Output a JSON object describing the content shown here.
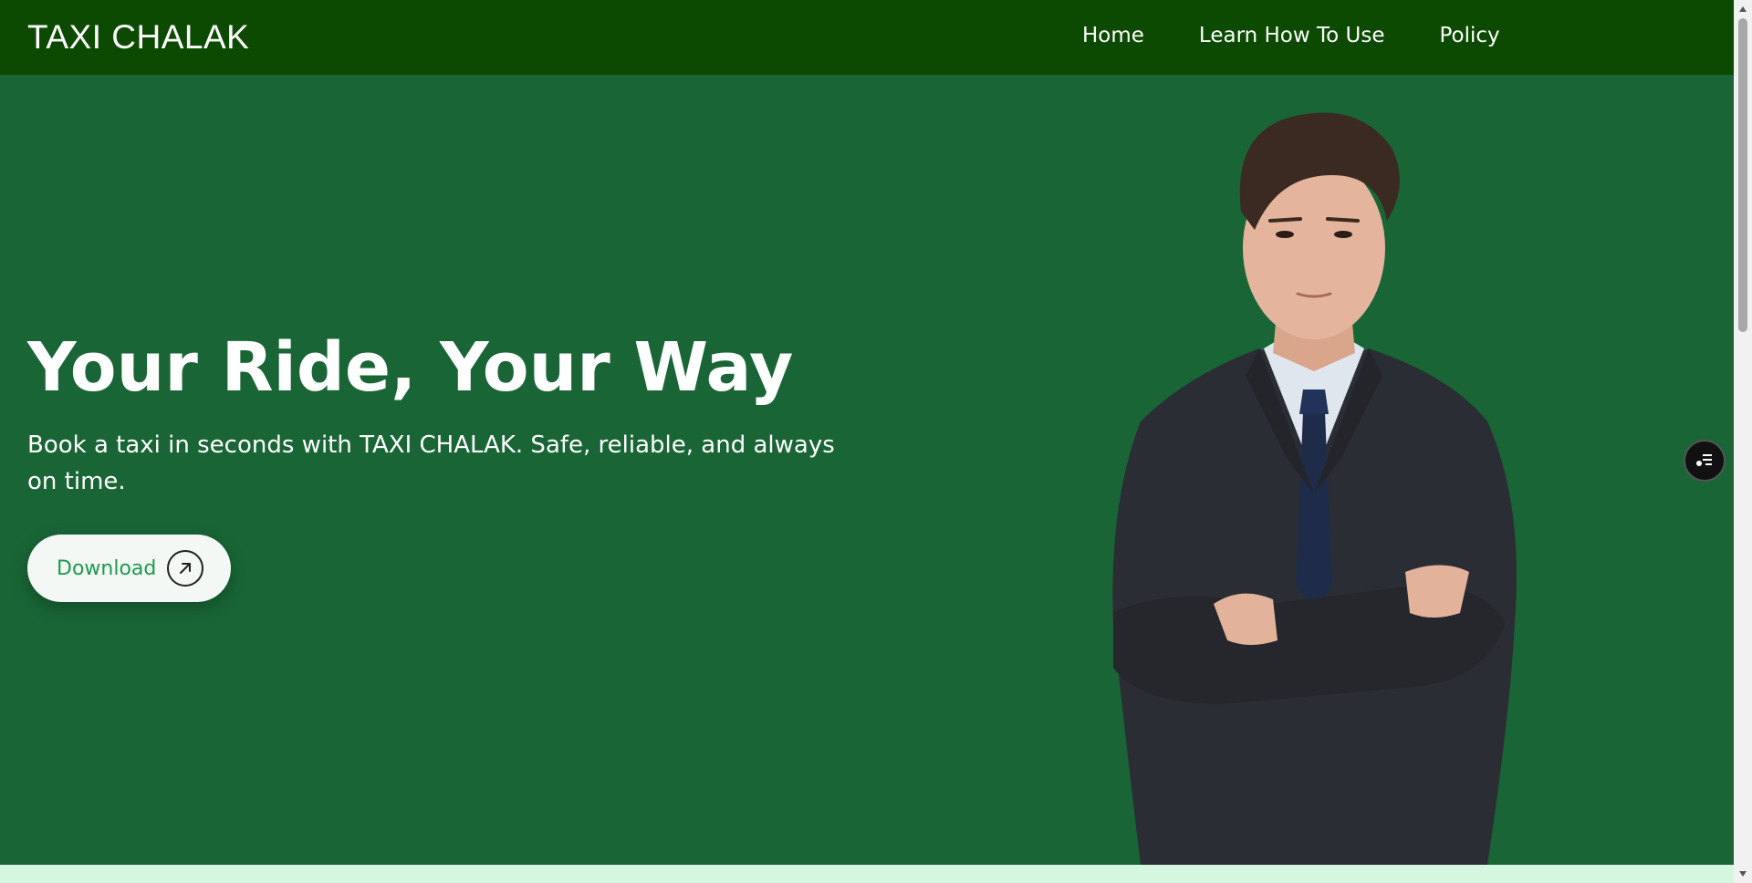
{
  "nav": {
    "brand": "TAXI CHALAK",
    "links": [
      "Home",
      "Learn How To Use",
      "Policy"
    ]
  },
  "hero": {
    "title": "Your Ride, Your Way",
    "subtitle": "Book a taxi in seconds with TAXI CHALAK. Safe, reliable, and always on time.",
    "download_label": "Download"
  },
  "colors": {
    "nav_bg": "#0b4a00",
    "hero_bg": "#196536",
    "button_text": "#1f9a4c",
    "bottom_strip": "#d6f7df"
  },
  "icons": {
    "download_arrow": "arrow-up-right-icon",
    "floating": "list-settings-icon",
    "scroll_up": "chevron-up-icon",
    "scroll_down": "chevron-down-icon"
  }
}
